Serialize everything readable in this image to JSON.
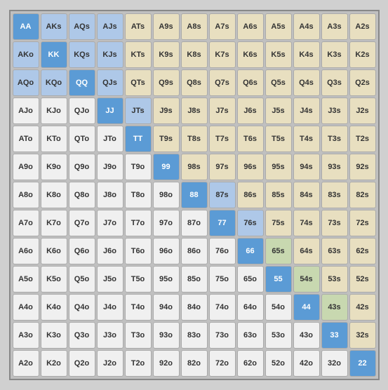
{
  "grid": {
    "cells": [
      [
        "AA",
        "AKs",
        "AQs",
        "AJs",
        "ATs",
        "A9s",
        "A8s",
        "A7s",
        "A6s",
        "A5s",
        "A4s",
        "A3s",
        "A2s"
      ],
      [
        "AKo",
        "KK",
        "KQs",
        "KJs",
        "KTs",
        "K9s",
        "K8s",
        "K7s",
        "K6s",
        "K5s",
        "K4s",
        "K3s",
        "K2s"
      ],
      [
        "AQo",
        "KQo",
        "QQ",
        "QJs",
        "QTs",
        "Q9s",
        "Q8s",
        "Q7s",
        "Q6s",
        "Q5s",
        "Q4s",
        "Q3s",
        "Q2s"
      ],
      [
        "AJo",
        "KJo",
        "QJo",
        "JJ",
        "JTs",
        "J9s",
        "J8s",
        "J7s",
        "J6s",
        "J5s",
        "J4s",
        "J3s",
        "J2s"
      ],
      [
        "ATo",
        "KTo",
        "QTo",
        "JTo",
        "TT",
        "T9s",
        "T8s",
        "T7s",
        "T6s",
        "T5s",
        "T4s",
        "T3s",
        "T2s"
      ],
      [
        "A9o",
        "K9o",
        "Q9o",
        "J9o",
        "T9o",
        "99",
        "98s",
        "97s",
        "96s",
        "95s",
        "94s",
        "93s",
        "92s"
      ],
      [
        "A8o",
        "K8o",
        "Q8o",
        "J8o",
        "T8o",
        "98o",
        "88",
        "87s",
        "86s",
        "85s",
        "84s",
        "83s",
        "82s"
      ],
      [
        "A7o",
        "K7o",
        "Q7o",
        "J7o",
        "T7o",
        "97o",
        "87o",
        "77",
        "76s",
        "75s",
        "74s",
        "73s",
        "72s"
      ],
      [
        "A6o",
        "K6o",
        "Q6o",
        "J6o",
        "T6o",
        "96o",
        "86o",
        "76o",
        "66",
        "65s",
        "64s",
        "63s",
        "62s"
      ],
      [
        "A5o",
        "K5o",
        "Q5o",
        "J5o",
        "T5o",
        "95o",
        "85o",
        "75o",
        "65o",
        "55",
        "54s",
        "53s",
        "52s"
      ],
      [
        "A4o",
        "K4o",
        "Q4o",
        "J4o",
        "T4o",
        "94o",
        "84o",
        "74o",
        "64o",
        "54o",
        "44",
        "43s",
        "42s"
      ],
      [
        "A3o",
        "K3o",
        "Q3o",
        "J3o",
        "T3o",
        "93o",
        "83o",
        "73o",
        "63o",
        "53o",
        "43o",
        "33",
        "32s"
      ],
      [
        "A2o",
        "K2o",
        "Q2o",
        "J2o",
        "T2o",
        "92o",
        "82o",
        "72o",
        "62o",
        "52o",
        "42o",
        "32o",
        "22"
      ]
    ],
    "colors": [
      [
        "bd",
        "bl",
        "bl",
        "bl",
        "be",
        "be",
        "be",
        "be",
        "be",
        "be",
        "be",
        "be",
        "be"
      ],
      [
        "bl",
        "bd",
        "bl",
        "bl",
        "be",
        "be",
        "be",
        "be",
        "be",
        "be",
        "be",
        "be",
        "be"
      ],
      [
        "bl",
        "bl",
        "bd",
        "bl",
        "be",
        "be",
        "be",
        "be",
        "be",
        "be",
        "be",
        "be",
        "be"
      ],
      [
        "wg",
        "wg",
        "wg",
        "bd",
        "bl",
        "be",
        "be",
        "be",
        "be",
        "be",
        "be",
        "be",
        "be"
      ],
      [
        "wg",
        "wg",
        "wg",
        "wg",
        "bd",
        "be",
        "be",
        "be",
        "be",
        "be",
        "be",
        "be",
        "be"
      ],
      [
        "wg",
        "wg",
        "wg",
        "wg",
        "wg",
        "bd",
        "be",
        "be",
        "be",
        "be",
        "be",
        "be",
        "be"
      ],
      [
        "wg",
        "wg",
        "wg",
        "wg",
        "wg",
        "wg",
        "bd",
        "bl",
        "be",
        "be",
        "be",
        "be",
        "be"
      ],
      [
        "wg",
        "wg",
        "wg",
        "wg",
        "wg",
        "wg",
        "wg",
        "bd",
        "bl",
        "be",
        "be",
        "be",
        "be"
      ],
      [
        "wg",
        "wg",
        "wg",
        "wg",
        "wg",
        "wg",
        "wg",
        "wg",
        "bd",
        "gl",
        "be",
        "be",
        "be"
      ],
      [
        "wg",
        "wg",
        "wg",
        "wg",
        "wg",
        "wg",
        "wg",
        "wg",
        "wg",
        "bd",
        "gl",
        "be",
        "be"
      ],
      [
        "wg",
        "wg",
        "wg",
        "wg",
        "wg",
        "wg",
        "wg",
        "wg",
        "wg",
        "wg",
        "bd",
        "gl",
        "be"
      ],
      [
        "wg",
        "wg",
        "wg",
        "wg",
        "wg",
        "wg",
        "wg",
        "wg",
        "wg",
        "wg",
        "wg",
        "bd",
        "be"
      ],
      [
        "wg",
        "wg",
        "wg",
        "wg",
        "wg",
        "wg",
        "wg",
        "wg",
        "wg",
        "wg",
        "wg",
        "wg",
        "bd"
      ]
    ]
  }
}
